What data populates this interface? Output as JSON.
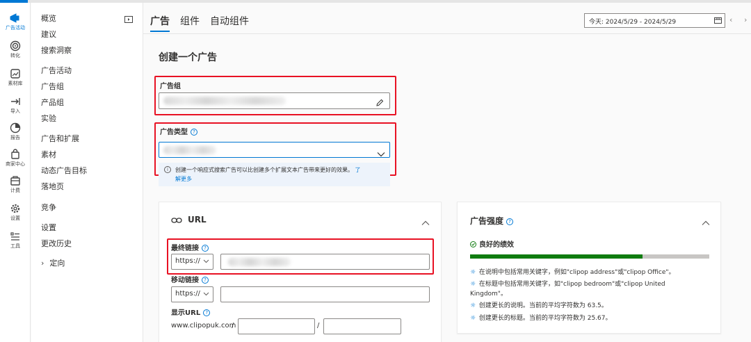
{
  "rail": [
    {
      "label": "广告活动",
      "icon": "megaphone-icon",
      "active": true
    },
    {
      "label": "转化",
      "icon": "target-icon"
    },
    {
      "label": "素材库",
      "icon": "image-edit-icon"
    },
    {
      "label": "导入",
      "icon": "import-arrow-icon"
    },
    {
      "label": "报告",
      "icon": "report-chart-icon"
    },
    {
      "label": "商家中心",
      "icon": "shopping-bag-icon"
    },
    {
      "label": "计费",
      "icon": "billing-icon"
    },
    {
      "label": "设置",
      "icon": "gear-icon"
    },
    {
      "label": "工具",
      "icon": "tools-icon"
    }
  ],
  "nav": [
    {
      "label": "概览"
    },
    {
      "label": "建议"
    },
    {
      "label": "搜索洞察"
    },
    {
      "label": "广告活动"
    },
    {
      "label": "广告组"
    },
    {
      "label": "产品组"
    },
    {
      "label": "实验"
    },
    {
      "label": "广告和扩展"
    },
    {
      "label": "素材"
    },
    {
      "label": "动态广告目标"
    },
    {
      "label": "落地页"
    },
    {
      "label": "竞争"
    },
    {
      "label": "设置"
    },
    {
      "label": "更改历史"
    },
    {
      "label": "定向"
    }
  ],
  "tabs": [
    {
      "label": "广告",
      "active": true
    },
    {
      "label": "组件"
    },
    {
      "label": "自动组件"
    }
  ],
  "date_range": "今天: 2024/5/29 - 2024/5/29",
  "page_title": "创建一个广告",
  "ad_group": {
    "label": "广告组"
  },
  "ad_type": {
    "label": "广告类型",
    "info": "创建一个响应式搜索广告可以比创建多个扩展文本广告带来更好的效果。",
    "link_part1": "了",
    "link_part2": "解更多"
  },
  "url_card": {
    "title": "URL",
    "final_url_label": "最终链接",
    "mobile_url_label": "移动链接",
    "display_url_label": "显示URL",
    "protocol": "https://",
    "domain": "www.clipopuk.com",
    "slash": "/"
  },
  "strength_card": {
    "title": "广告强度",
    "status": "良好的绩效",
    "progress_percent": 72,
    "tips": [
      "在说明中包括常用关键字，例如\"clipop address\"或\"clipop Office\"。",
      "在标题中包括常用关键字，如\"clipop bedroom\"或\"clipop United",
      "Kingdom\"。",
      "创建更长的说明。当前的平均字符数为 63.5。",
      "创建更长的标题。当前的平均字符数为 25.67。"
    ]
  },
  "colors": {
    "accent": "#0078d4",
    "success": "#107c10",
    "highlight": "#e81123"
  }
}
